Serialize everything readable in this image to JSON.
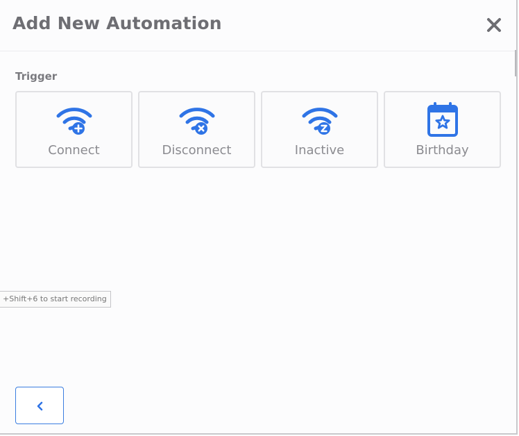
{
  "dialog": {
    "title": "Add New Automation",
    "close_icon": "close-icon"
  },
  "trigger": {
    "label": "Trigger",
    "options": [
      {
        "label": "Connect",
        "icon": "wifi-plus-icon"
      },
      {
        "label": "Disconnect",
        "icon": "wifi-x-icon"
      },
      {
        "label": "Inactive",
        "icon": "wifi-sleep-icon"
      },
      {
        "label": "Birthday",
        "icon": "calendar-star-icon"
      }
    ]
  },
  "tooltip": {
    "text": "+Shift+6 to start recording"
  },
  "footer": {
    "back_icon": "chevron-left-icon"
  },
  "colors": {
    "accent": "#2f74e6",
    "text_muted": "#8b8b90",
    "card_border": "#e1e1e4"
  }
}
